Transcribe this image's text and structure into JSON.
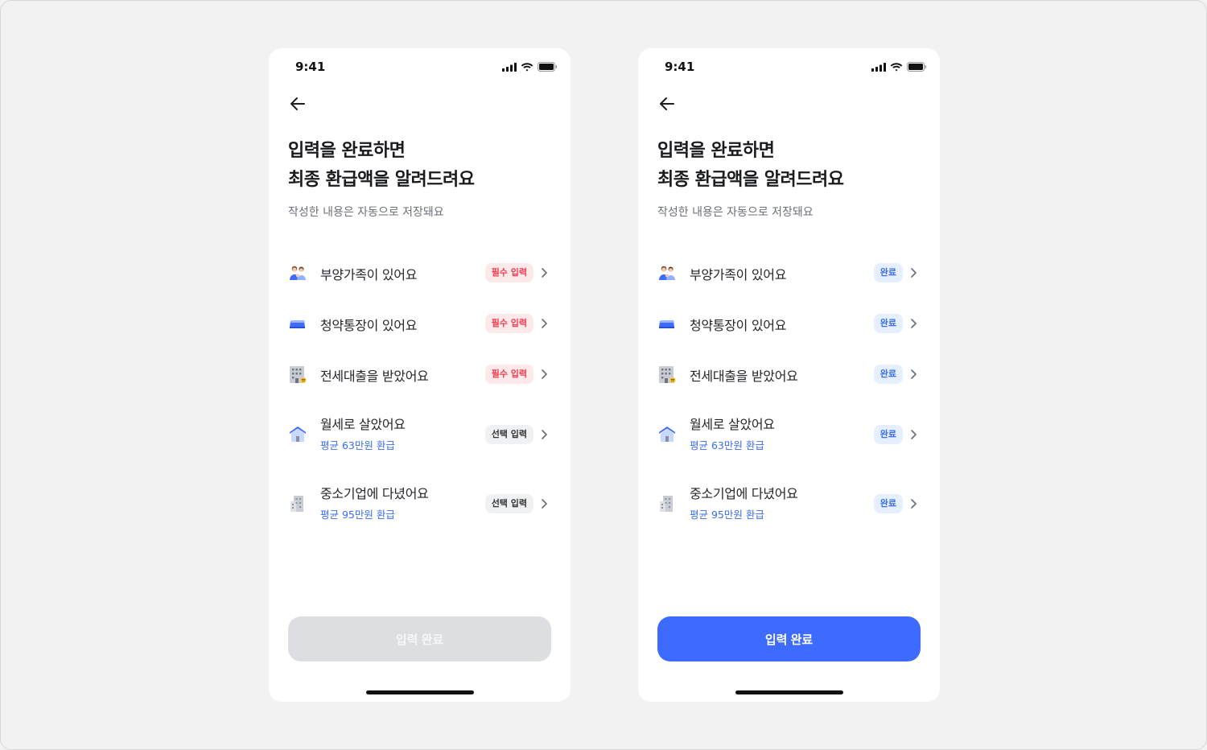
{
  "screens": [
    {
      "status_time": "9:41",
      "title_line1": "입력을 완료하면",
      "title_line2": "최종 환급액을 알려드려요",
      "subtitle": "작성한 내용은 자동으로 저장돼요",
      "items": [
        {
          "label": "부양가족이 있어요",
          "badge": "필수 입력",
          "badge_type": "required",
          "icon": "family-icon"
        },
        {
          "label": "청약통장이 있어요",
          "badge": "필수 입력",
          "badge_type": "required",
          "icon": "bankbook-icon"
        },
        {
          "label": "전세대출을 받았어요",
          "badge": "필수 입력",
          "badge_type": "required",
          "icon": "building-icon"
        },
        {
          "label": "월세로 살았어요",
          "sub": "평균 63만원 환급",
          "badge": "선택 입력",
          "badge_type": "optional",
          "icon": "house-icon"
        },
        {
          "label": "중소기업에 다녔어요",
          "sub": "평균 95만원 환급",
          "badge": "선택 입력",
          "badge_type": "optional",
          "icon": "office-icon"
        }
      ],
      "cta": "입력 완료",
      "cta_state": "disabled"
    },
    {
      "status_time": "9:41",
      "title_line1": "입력을 완료하면",
      "title_line2": "최종 환급액을 알려드려요",
      "subtitle": "작성한 내용은 자동으로 저장돼요",
      "items": [
        {
          "label": "부양가족이 있어요",
          "badge": "완료",
          "badge_type": "done",
          "icon": "family-icon"
        },
        {
          "label": "청약통장이 있어요",
          "badge": "완료",
          "badge_type": "done",
          "icon": "bankbook-icon"
        },
        {
          "label": "전세대출을 받았어요",
          "badge": "완료",
          "badge_type": "done",
          "icon": "building-icon"
        },
        {
          "label": "월세로 살았어요",
          "sub": "평균 63만원 환급",
          "badge": "완료",
          "badge_type": "done",
          "icon": "house-icon"
        },
        {
          "label": "중소기업에 다녔어요",
          "sub": "평균 95만원 환급",
          "badge": "완료",
          "badge_type": "done",
          "icon": "office-icon"
        }
      ],
      "cta": "입력 완료",
      "cta_state": "active"
    }
  ],
  "colors": {
    "primary": "#3e6bff",
    "required_text": "#ee3d4f",
    "required_bg": "#fde8ea",
    "done_bg": "#e6efff",
    "disabled_button": "#dcdee2"
  }
}
